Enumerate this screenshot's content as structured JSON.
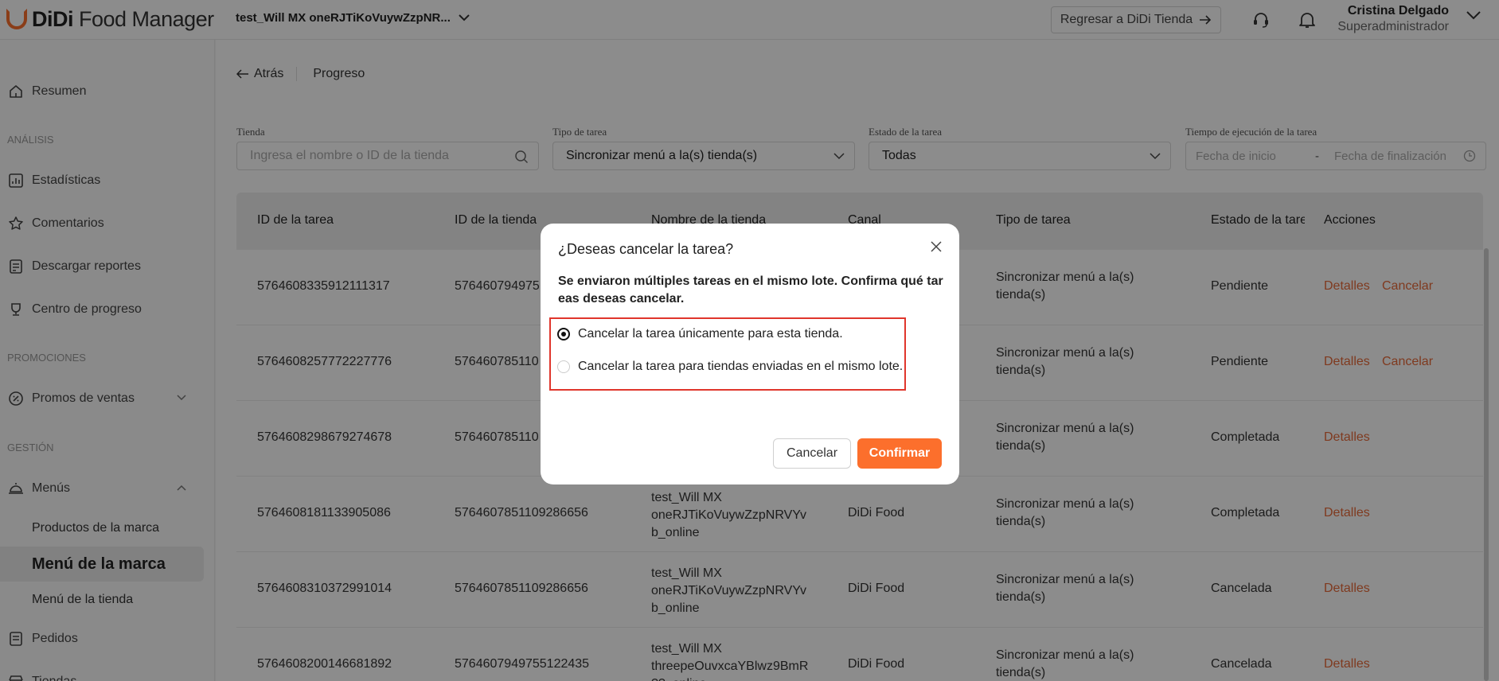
{
  "header": {
    "logo_brand": "DiDi",
    "logo_product": "Food Manager",
    "store_name": "test_Will MX oneRJTiKoVuywZzpNR...",
    "return_button": "Regresar a DiDi Tienda",
    "user_name": "Cristina Delgado",
    "user_role": "Superadministrador"
  },
  "sidebar": {
    "resumen": "Resumen",
    "section_analisis": "ANÁLISIS",
    "estadisticas": "Estadísticas",
    "comentarios": "Comentarios",
    "descargar": "Descargar reportes",
    "progreso": "Centro de progreso",
    "section_promociones": "PROMOCIONES",
    "promos": "Promos de ventas",
    "section_gestion": "GESTIÓN",
    "menus": "Menús",
    "productos": "Productos de la marca",
    "menu_marca": "Menú de la marca",
    "menu_tienda": "Menú de la tienda",
    "pedidos": "Pedidos",
    "tiendas": "Tiendas"
  },
  "breadcrumb": {
    "back": "Atrás",
    "current": "Progreso"
  },
  "filters": {
    "tienda_label": "Tienda",
    "tienda_placeholder": "Ingresa el nombre o ID de la tienda",
    "tipo_label": "Tipo de tarea",
    "tipo_value": "Sincronizar menú a la(s) tienda(s)",
    "estado_label": "Estado de la tarea",
    "estado_value": "Todas",
    "tiempo_label": "Tiempo de ejecución de la tarea",
    "fecha_inicio": "Fecha de inicio",
    "separator": "-",
    "fecha_fin": "Fecha de finalización"
  },
  "table": {
    "headers": [
      "ID de la tarea",
      "ID de la tienda",
      "Nombre de la tienda",
      "Canal",
      "Tipo de tarea",
      "Estado de la tarea",
      "Acciones"
    ],
    "rows": [
      {
        "task_id": "5764608335912111317",
        "store_id": "576460794975",
        "name1": "",
        "name2": "",
        "name3": "",
        "channel": "",
        "type1": "Sincronizar menú a la(s)",
        "type2": "tienda(s)",
        "status": "Pendiente",
        "details": "Detalles",
        "cancel": "Cancelar"
      },
      {
        "task_id": "5764608257772227776",
        "store_id": "576460785110",
        "name1": "",
        "name2": "",
        "name3": "",
        "channel": "",
        "type1": "Sincronizar menú a la(s)",
        "type2": "tienda(s)",
        "status": "Pendiente",
        "details": "Detalles",
        "cancel": "Cancelar"
      },
      {
        "task_id": "5764608298679274678",
        "store_id": "576460785110",
        "name1": "",
        "name2": "",
        "name3": "",
        "channel": "",
        "type1": "Sincronizar menú a la(s)",
        "type2": "tienda(s)",
        "status": "Completada",
        "details": "Detalles",
        "cancel": ""
      },
      {
        "task_id": "5764608181133905086",
        "store_id": "5764607851109286656",
        "name1": "test_Will MX",
        "name2": "oneRJTiKoVuywZzpNRVYv",
        "name3": "b_online",
        "channel": "DiDi Food",
        "type1": "Sincronizar menú a la(s)",
        "type2": "tienda(s)",
        "status": "Completada",
        "details": "Detalles",
        "cancel": ""
      },
      {
        "task_id": "5764608310372991014",
        "store_id": "5764607851109286656",
        "name1": "test_Will MX",
        "name2": "oneRJTiKoVuywZzpNRVYv",
        "name3": "b_online",
        "channel": "DiDi Food",
        "type1": "Sincronizar menú a la(s)",
        "type2": "tienda(s)",
        "status": "Cancelada",
        "details": "Detalles",
        "cancel": ""
      },
      {
        "task_id": "5764608200146681892",
        "store_id": "5764607949755122435",
        "name1": "test_Will MX",
        "name2": "threepeOuvxcaYBlwz9BmR",
        "name3": "??_online",
        "channel": "DiDi Food",
        "type1": "Sincronizar menú a la(s)",
        "type2": "tienda(s)",
        "status": "Cancelada",
        "details": "Detalles",
        "cancel": ""
      }
    ]
  },
  "modal": {
    "title": "¿Deseas cancelar la tarea?",
    "description": "Se enviaron múltiples tareas en el mismo lote. Confirma qué tareas deseas cancelar.",
    "option1": "Cancelar la tarea únicamente para esta tienda.",
    "option2": "Cancelar la tarea para tiendas enviadas en el mismo lote.",
    "cancel_button": "Cancelar",
    "confirm_button": "Confirmar"
  },
  "colors": {
    "accent": "#fc6f2c",
    "link": "#e86a3a",
    "highlight_border": "#e0362c"
  }
}
